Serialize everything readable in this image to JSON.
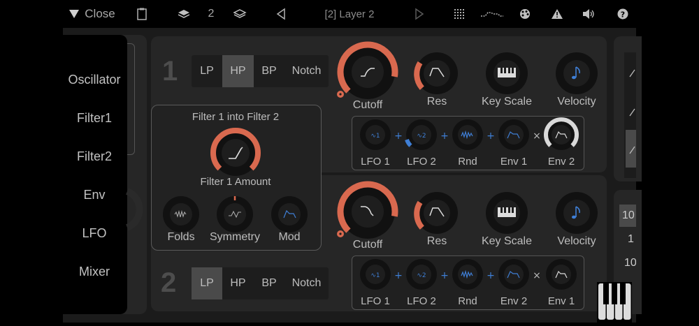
{
  "topbar": {
    "close_label": "Close",
    "layer_count": "2",
    "layer_title": "[2] Layer 2"
  },
  "sidebar": {
    "items": [
      {
        "label": "Oscillator"
      },
      {
        "label": "Filter1"
      },
      {
        "label": "Filter2"
      },
      {
        "label": "Env"
      },
      {
        "label": "LFO"
      },
      {
        "label": "Mixer"
      }
    ]
  },
  "filter1": {
    "number": "1",
    "types": [
      "LP",
      "HP",
      "BP",
      "Notch"
    ],
    "selected_type": "HP",
    "knobs": {
      "cutoff": "Cutoff",
      "res": "Res",
      "key_scale": "Key Scale",
      "velocity": "Velocity"
    },
    "mods": {
      "lfo1": "LFO 1",
      "lfo2": "LFO 2",
      "rnd": "Rnd",
      "env1": "Env 1",
      "env2": "Env 2"
    }
  },
  "filter2": {
    "number": "2",
    "types": [
      "LP",
      "HP",
      "BP",
      "Notch"
    ],
    "selected_type": "LP",
    "knobs": {
      "cutoff": "Cutoff",
      "res": "Res",
      "key_scale": "Key Scale",
      "velocity": "Velocity"
    },
    "mods": {
      "lfo1": "LFO 1",
      "lfo2": "LFO 2",
      "rnd": "Rnd",
      "env2": "Env 2",
      "env1": "Env 1"
    }
  },
  "popup": {
    "title": "Filter 1 into Filter 2",
    "amount_label": "Filter 1 Amount",
    "folds_label": "Folds",
    "symmetry_label": "Symmetry",
    "mod_label": "Mod"
  },
  "right_panel": {
    "values": [
      "10",
      "1",
      "10"
    ]
  },
  "colors": {
    "accent": "#d9694f",
    "blue": "#3f7fd6",
    "panel": "#262626",
    "background": "#1b1b1b"
  }
}
